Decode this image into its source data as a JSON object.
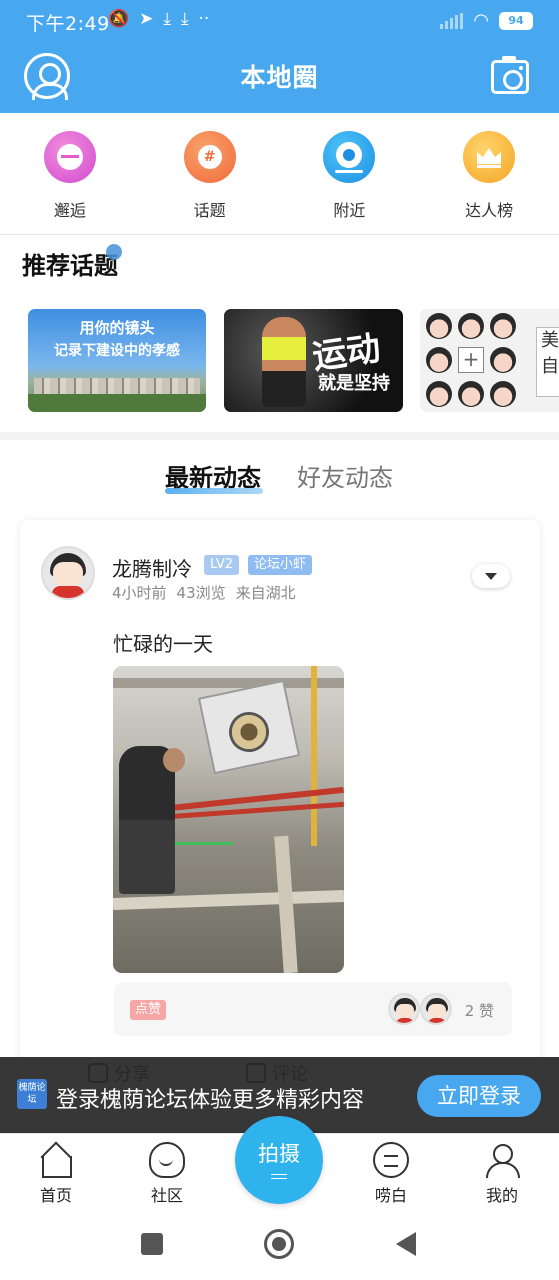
{
  "status_bar": {
    "time": "下午2:49",
    "battery": "94"
  },
  "header": {
    "title": "本地圈",
    "brand_color": "#47a8f0"
  },
  "entries": [
    {
      "label": "邂逅",
      "icon": "heart-pulse-icon"
    },
    {
      "label": "话题",
      "icon": "hashtag-icon"
    },
    {
      "label": "附近",
      "icon": "location-pin-icon"
    },
    {
      "label": "达人榜",
      "icon": "crown-icon"
    }
  ],
  "recommended": {
    "title": "推荐话题",
    "banners": [
      {
        "line1": "用你的镜头",
        "line2": "记录下建设中的孝感"
      },
      {
        "line1": "运动",
        "line2": "就是坚持"
      },
      {
        "edge_text": "美\n自"
      }
    ]
  },
  "tabs": {
    "latest": "最新动态",
    "friends": "好友动态"
  },
  "post": {
    "author": "龙腾制冷",
    "level": "LV2",
    "role": "论坛小虾",
    "time": "4小时前",
    "views": "43浏览",
    "location": "来自湖北",
    "text": "忙碌的一天",
    "like_tag": "点赞",
    "like_count": "2 赞"
  },
  "actions": {
    "share": "分享",
    "comment": "评论"
  },
  "login_banner": {
    "logo_text": "槐荫论坛",
    "text": "登录槐荫论坛体验更多精彩内容",
    "button": "立即登录"
  },
  "bottom_nav": {
    "home": "首页",
    "community": "社区",
    "shoot": "拍摄",
    "chat": "唠白",
    "me": "我的"
  }
}
